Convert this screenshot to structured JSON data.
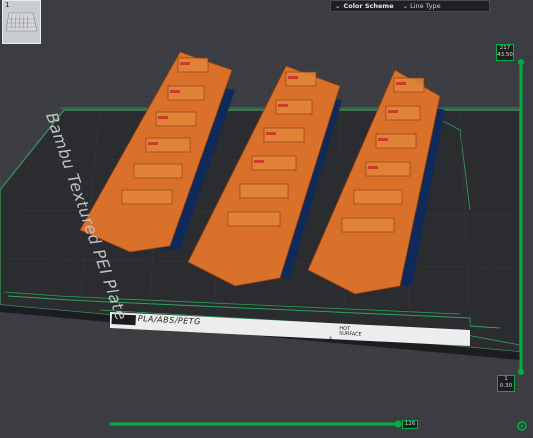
{
  "toolbar": {
    "plate_number": "1"
  },
  "color_scheme": {
    "label": "Color Scheme",
    "value": "Line Type"
  },
  "plate": {
    "name": "Bambu Textured PEI Plate",
    "material_label": "PLA/ABS/PETG",
    "hot_surface_label_1": "HOT",
    "hot_surface_label_2": "SURFACE"
  },
  "vertical_slider": {
    "top_layer": "217",
    "top_height": "43.50",
    "bottom_layer": "1",
    "bottom_height": "0.30"
  },
  "horizontal_slider": {
    "value": "126"
  },
  "colors": {
    "accent": "#00ae42",
    "part": "#e07a2e",
    "bed": "#2a2b2e"
  }
}
